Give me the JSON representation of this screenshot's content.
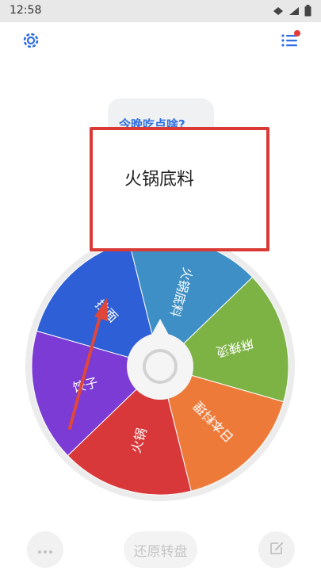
{
  "status_bar": {
    "time": "12:58"
  },
  "question": "今晚吃点啥?",
  "result": "火锅底料",
  "wheel": {
    "segments": [
      {
        "label": "火锅底料",
        "color": "#3d8fc6"
      },
      {
        "label": "麻辣烫",
        "color": "#7db345"
      },
      {
        "label": "日本料理",
        "color": "#ee7a3a"
      },
      {
        "label": "火锅",
        "color": "#d8383a"
      },
      {
        "label": "饺子",
        "color": "#7b3bd4"
      },
      {
        "label": "拉面",
        "color": "#2f5fd6"
      }
    ]
  },
  "bottom": {
    "reset_label": "还原转盘"
  },
  "colors": {
    "accent": "#2f6fe0",
    "highlight_box": "#d93a36",
    "arrow": "#e0473a"
  }
}
